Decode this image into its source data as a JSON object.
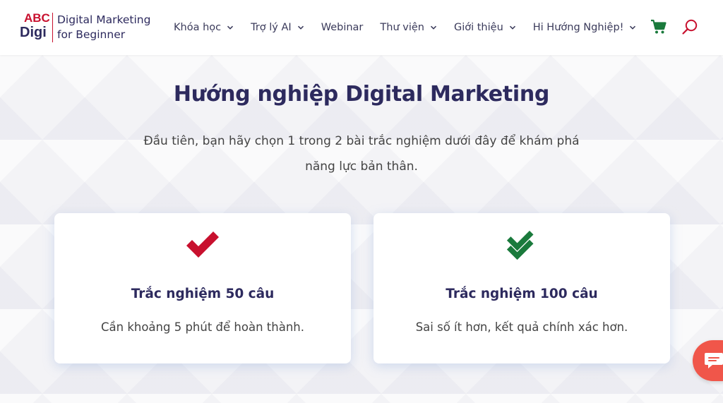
{
  "logo": {
    "mark_top": "ABC",
    "mark_bottom": "Digi",
    "line1": "Digital Marketing",
    "line2": "for Beginner"
  },
  "nav": {
    "items": [
      {
        "label": "Khóa học",
        "has_dropdown": true
      },
      {
        "label": "Trợ lý AI",
        "has_dropdown": true
      },
      {
        "label": "Webinar",
        "has_dropdown": false
      },
      {
        "label": "Thư viện",
        "has_dropdown": true
      },
      {
        "label": "Giới thiệu",
        "has_dropdown": true
      },
      {
        "label": "Hi Hướng Nghiệp!",
        "has_dropdown": true
      }
    ],
    "cart_icon": "cart-icon",
    "search_icon": "search-icon"
  },
  "main": {
    "title": "Hướng nghiệp Digital Marketing",
    "intro": "Đầu tiên, bạn hãy chọn 1 trong 2 bài trắc nghiệm dưới đây để khám phá năng lực bản thân.",
    "cards": [
      {
        "icon": "check-icon",
        "icon_color": "#c8102e",
        "title": "Trắc nghiệm 50 câu",
        "desc": "Cần khoảng 5 phút để hoàn thành."
      },
      {
        "icon": "double-check-icon",
        "icon_color": "#1a7a3c",
        "title": "Trắc nghiệm 100 câu",
        "desc": "Sai số ít hơn, kết quả chính xác hơn."
      }
    ]
  },
  "chat": {
    "icon": "chat-icon",
    "color": "#f0564a"
  },
  "colors": {
    "brand_navy": "#2d2a5e",
    "brand_red": "#c8102e",
    "cart_green": "#1a7a3c"
  }
}
